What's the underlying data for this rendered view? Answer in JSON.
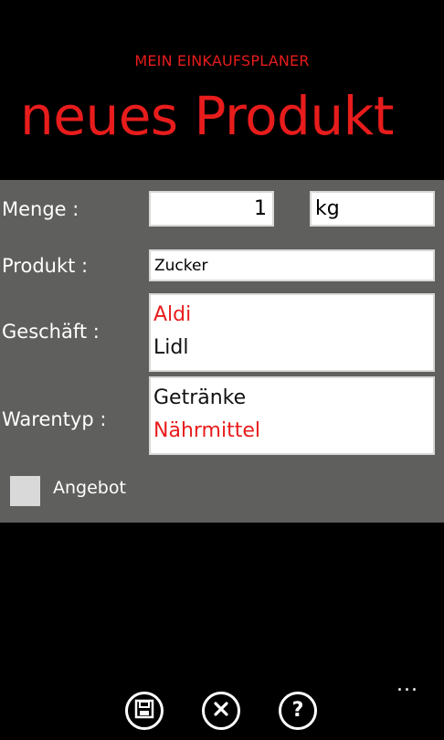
{
  "header": {
    "app_title": "MEIN EINKAUFSPLANER",
    "page_title": "neues Produkt"
  },
  "form": {
    "quantity_label": "Menge :",
    "quantity_value": "1",
    "unit_value": "kg",
    "product_label": "Produkt :",
    "product_value": "Zucker",
    "store_label": "Geschäft :",
    "stores": [
      {
        "name": "Aldi",
        "selected": true
      },
      {
        "name": "Lidl",
        "selected": false
      }
    ],
    "type_label": "Warentyp :",
    "types": [
      {
        "name": "Getränke",
        "selected": false
      },
      {
        "name": "Nährmittel",
        "selected": true
      }
    ],
    "offer_label": "Angebot",
    "offer_checked": false
  },
  "appbar": {
    "buttons": [
      "save-icon",
      "cancel-icon",
      "help-icon"
    ],
    "more_label": "..."
  },
  "colors": {
    "accent": "#e81c1c",
    "panel": "#5f5f5d",
    "background": "#000000"
  }
}
